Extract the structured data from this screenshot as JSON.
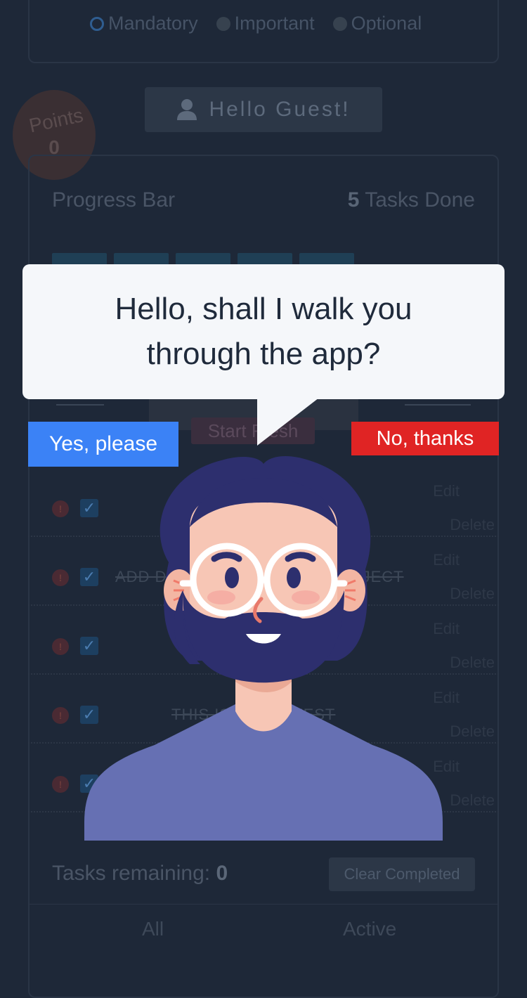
{
  "priority": {
    "options": [
      {
        "label": "Mandatory",
        "selected": true
      },
      {
        "label": "Important",
        "selected": false
      },
      {
        "label": "Optional",
        "selected": false
      }
    ]
  },
  "greeting": {
    "text": "Hello Guest!",
    "icon": "user-icon"
  },
  "points": {
    "label": "Points",
    "value": "0"
  },
  "progress": {
    "title": "Progress Bar",
    "done_count": "5",
    "done_label": "Tasks Done",
    "segments": 5
  },
  "actions": {
    "start_fresh": "Start Fresh"
  },
  "tasks": [
    {
      "text": "",
      "edit": "Edit",
      "delete": "Delete"
    },
    {
      "text": "ADD D",
      "text_tail": "OJECT",
      "edit": "Edit",
      "delete": "Delete"
    },
    {
      "text": "F",
      "edit": "Edit",
      "delete": "Delete"
    },
    {
      "text": "THIS IS",
      "text_tail": "L TEST",
      "edit": "Edit",
      "delete": "Delete"
    },
    {
      "text": "",
      "edit": "Edit",
      "delete": "Delete"
    }
  ],
  "footer": {
    "remaining_label": "Tasks remaining:",
    "remaining_count": "0",
    "clear_label": "Clear Completed",
    "filters": [
      "All",
      "Active"
    ]
  },
  "tour": {
    "message": "Hello, shall I walk you through the app?",
    "yes_label": "Yes, please",
    "no_label": "No, thanks",
    "yes_color": "#3b82f6",
    "no_color": "#e02424"
  },
  "colors": {
    "background": "#1e2838",
    "bubble": "#f5f7fa",
    "avatar_hair": "#2d2f6e",
    "avatar_shirt": "#6670b3",
    "avatar_skin": "#f7c6b5"
  }
}
